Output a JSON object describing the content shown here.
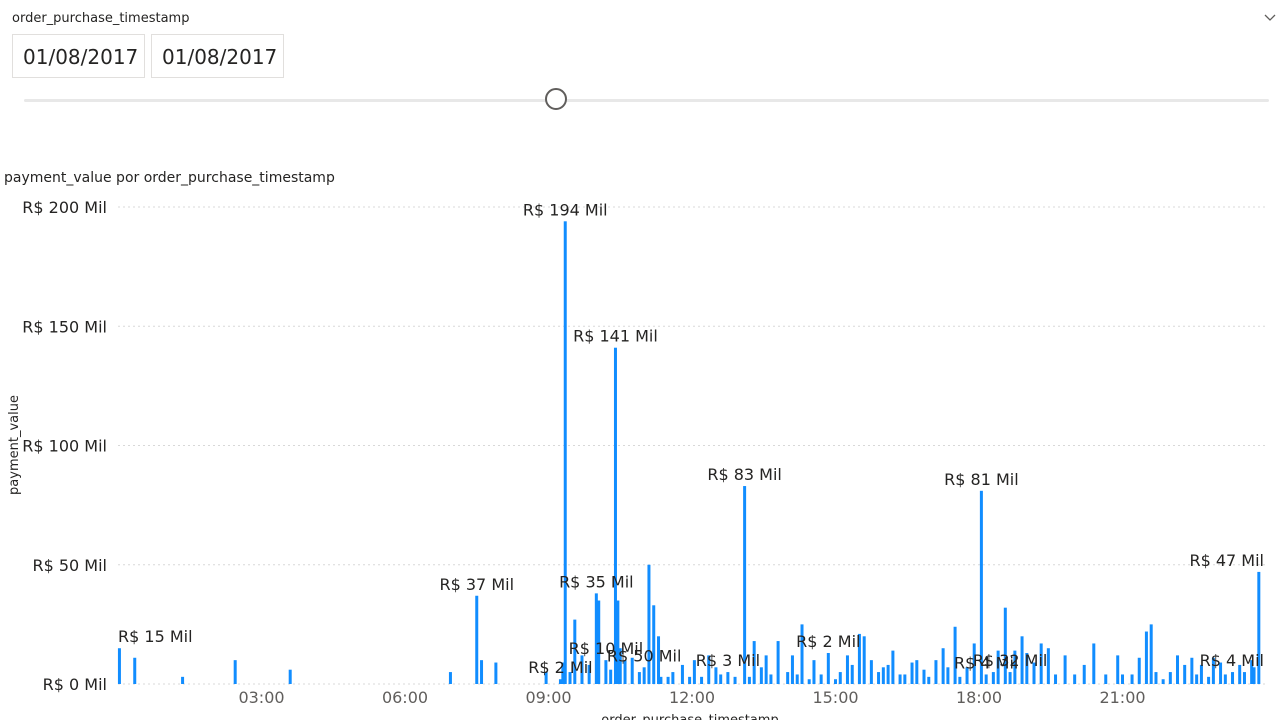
{
  "slicer": {
    "title": "order_purchase_timestamp",
    "start_date": "01/08/2017",
    "end_date": "01/08/2017",
    "icon": "chevron-down-icon"
  },
  "chart_data": {
    "type": "bar",
    "title": "payment_value por order_purchase_timestamp",
    "xlabel": "order_purchase_timestamp",
    "ylabel": "payment_value",
    "ylim": [
      0,
      200
    ],
    "xlim": [
      0,
      24
    ],
    "y_ticks": [
      "R$ 0 Mil",
      "R$ 50 Mil",
      "R$ 100 Mil",
      "R$ 150 Mil",
      "R$ 200 Mil"
    ],
    "x_ticks": [
      "03:00",
      "06:00",
      "09:00",
      "12:00",
      "15:00",
      "18:00",
      "21:00"
    ],
    "grid": true,
    "bar_color": "#118dff",
    "x": [
      0.03,
      0.35,
      1.35,
      2.45,
      3.6,
      6.95,
      7.5,
      7.6,
      7.9,
      8.95,
      9.25,
      9.3,
      9.35,
      9.45,
      9.55,
      9.7,
      9.85,
      10.0,
      10.05,
      10.2,
      10.3,
      10.4,
      10.45,
      10.5,
      10.6,
      10.75,
      10.9,
      11.0,
      11.1,
      11.2,
      11.3,
      11.35,
      11.5,
      11.6,
      11.8,
      11.95,
      12.05,
      12.2,
      12.35,
      12.5,
      12.6,
      12.75,
      12.9,
      13.1,
      13.2,
      13.3,
      13.45,
      13.55,
      13.65,
      13.8,
      14.0,
      14.1,
      14.2,
      14.3,
      14.45,
      14.55,
      14.7,
      14.85,
      15.0,
      15.1,
      15.25,
      15.35,
      15.5,
      15.6,
      15.75,
      15.9,
      16.0,
      16.1,
      16.2,
      16.35,
      16.45,
      16.6,
      16.7,
      16.85,
      16.95,
      17.1,
      17.25,
      17.35,
      17.5,
      17.6,
      17.75,
      17.9,
      18.05,
      18.15,
      18.3,
      18.4,
      18.55,
      18.65,
      18.75,
      18.9,
      19.0,
      19.15,
      19.3,
      19.45,
      19.6,
      19.8,
      20.0,
      20.2,
      20.4,
      20.65,
      20.9,
      21.0,
      21.2,
      21.35,
      21.5,
      21.6,
      21.7,
      21.85,
      22.0,
      22.15,
      22.3,
      22.45,
      22.55,
      22.65,
      22.8,
      22.9,
      23.05,
      23.15,
      23.3,
      23.45,
      23.55,
      23.7,
      23.75,
      23.85
    ],
    "values": [
      15,
      11,
      3,
      10,
      6,
      5,
      37,
      10,
      9,
      5,
      2,
      9,
      194,
      5,
      27,
      12,
      8,
      38,
      35,
      10,
      6,
      141,
      35,
      15,
      10,
      11,
      5,
      7,
      50,
      33,
      20,
      3,
      3,
      5,
      8,
      3,
      10,
      3,
      12,
      7,
      4,
      5,
      3,
      83,
      3,
      18,
      7,
      12,
      4,
      18,
      5,
      12,
      4,
      25,
      2,
      10,
      4,
      13,
      2,
      5,
      12,
      8,
      21,
      20,
      10,
      5,
      7,
      8,
      14,
      4,
      4,
      9,
      10,
      6,
      3,
      10,
      15,
      7,
      24,
      3,
      7,
      17,
      81,
      4,
      5,
      14,
      32,
      5,
      14,
      20,
      13,
      9,
      17,
      15,
      4,
      12,
      4,
      8,
      17,
      4,
      12,
      4,
      4,
      11,
      22,
      25,
      5,
      2,
      5,
      12,
      8,
      11,
      4,
      8,
      3,
      11,
      9,
      4,
      5,
      8,
      5,
      10,
      7,
      47,
      5
    ],
    "data_labels": [
      {
        "x": 0.03,
        "text": "R$ 15 Mil"
      },
      {
        "x": 7.5,
        "text": "R$ 37 Mil"
      },
      {
        "x": 9.25,
        "text": "R$ 2 Mil"
      },
      {
        "x": 9.35,
        "text": "R$ 194 Mil"
      },
      {
        "x": 10.0,
        "text": "R$ 35 Mil"
      },
      {
        "x": 10.2,
        "text": "R$ 10 Mil"
      },
      {
        "x": 10.4,
        "text": "R$ 141 Mil"
      },
      {
        "x": 11.0,
        "text": "R$ 50 Mil"
      },
      {
        "x": 12.75,
        "text": "R$ 3 Mil"
      },
      {
        "x": 13.1,
        "text": "R$ 83 Mil"
      },
      {
        "x": 14.85,
        "text": "R$ 2 Mil"
      },
      {
        "x": 18.05,
        "text": "R$ 81 Mil"
      },
      {
        "x": 18.15,
        "text": "R$ 4 Mil"
      },
      {
        "x": 18.65,
        "text": "R$ 32 Mil"
      },
      {
        "x": 23.85,
        "text": "R$ 47 Mil"
      },
      {
        "x": 23.55,
        "text": "R$ 4 Mil"
      }
    ]
  }
}
